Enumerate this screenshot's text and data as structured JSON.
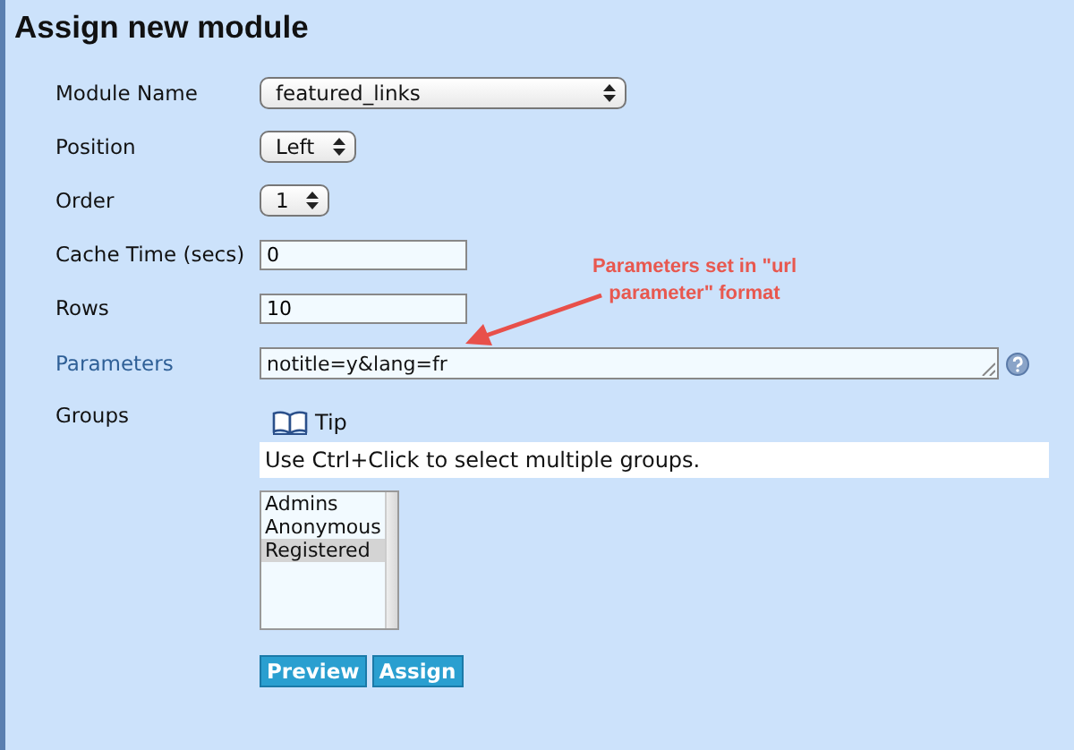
{
  "title": "Assign new module",
  "fields": [
    {
      "kind": "select",
      "label": "Module Name",
      "value": "featured_links"
    },
    {
      "kind": "select",
      "label": "Position",
      "value": "Left"
    },
    {
      "kind": "select",
      "label": "Order",
      "value": "1"
    },
    {
      "kind": "text",
      "label": "Cache Time (secs)",
      "value": "0"
    },
    {
      "kind": "text",
      "label": "Rows",
      "value": "10"
    },
    {
      "kind": "textarea",
      "label": "Parameters",
      "value": "notitle=y&lang=fr"
    }
  ],
  "groups": {
    "label": "Groups",
    "tip_label": "Tip",
    "tip_text": "Use Ctrl+Click to select multiple groups.",
    "options": [
      {
        "label": "Admins",
        "selected": false
      },
      {
        "label": "Anonymous",
        "selected": false
      },
      {
        "label": "Registered",
        "selected": true
      }
    ]
  },
  "annotation": "Parameters set in \"url parameter\" format",
  "buttons": [
    "Preview",
    "Assign"
  ]
}
